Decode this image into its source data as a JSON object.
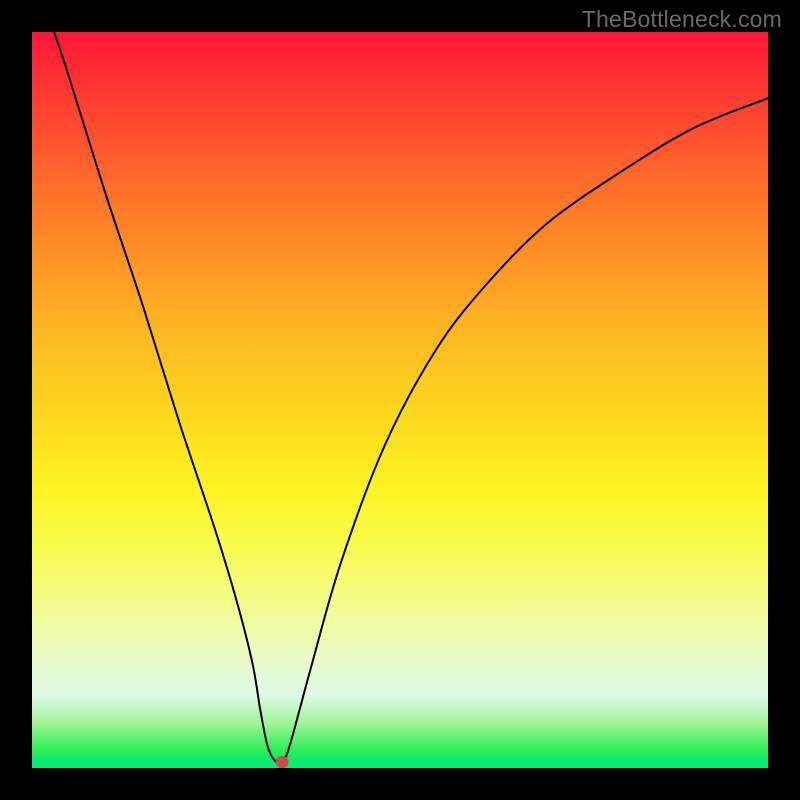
{
  "watermark": "TheBottleneck.com",
  "chart_data": {
    "type": "line",
    "title": "",
    "xlabel": "",
    "ylabel": "",
    "xlim": [
      0,
      100
    ],
    "ylim": [
      0,
      100
    ],
    "series": [
      {
        "name": "curve",
        "x": [
          3,
          5,
          10,
          15,
          20,
          25,
          28,
          30,
          31,
          32,
          33,
          34,
          35,
          38,
          42,
          48,
          55,
          62,
          70,
          80,
          90,
          100
        ],
        "y": [
          100,
          94,
          78,
          63,
          47,
          32,
          22,
          14,
          8,
          3,
          1,
          1,
          3,
          14,
          28,
          44,
          57,
          66,
          74,
          81,
          87,
          91
        ]
      }
    ],
    "annotations": [
      {
        "name": "marker",
        "x": 34,
        "y": 0.8,
        "color": "#cd4c48"
      }
    ],
    "background_gradient": {
      "top": "#fd1637",
      "mid": "#fde01e",
      "bottom": "#09ec78"
    }
  }
}
